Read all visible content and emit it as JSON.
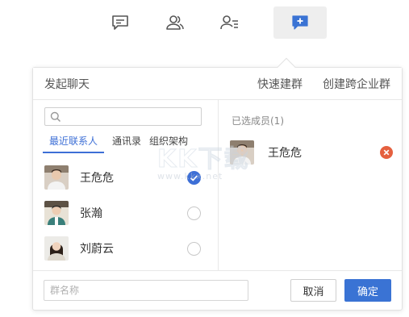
{
  "toolbar": {
    "buttons": [
      {
        "icon": "message-icon"
      },
      {
        "icon": "contacts-icon"
      },
      {
        "icon": "contact-list-icon"
      },
      {
        "icon": "new-chat-plus-icon",
        "active": true
      }
    ]
  },
  "panel": {
    "title": "发起聊天",
    "links": [
      "快速建群",
      "创建跨企业群"
    ]
  },
  "left": {
    "search_placeholder": "",
    "tabs": [
      "最近联系人",
      "通讯录",
      "组织架构"
    ],
    "contacts": [
      {
        "name": "王危危",
        "checked": true
      },
      {
        "name": "张瀚",
        "checked": false
      },
      {
        "name": "刘蔚云",
        "checked": false
      }
    ]
  },
  "right": {
    "selected_title": "已选成员(1)",
    "selected": [
      {
        "name": "王危危"
      }
    ]
  },
  "footer": {
    "group_name_placeholder": "群名称",
    "cancel_label": "取消",
    "confirm_label": "确定"
  },
  "watermark": {
    "big": "KK下载",
    "small": "www.kkx.net"
  },
  "colors": {
    "accent": "#3a73d4",
    "remove": "#e5603f",
    "border": "#e2e2e2"
  }
}
